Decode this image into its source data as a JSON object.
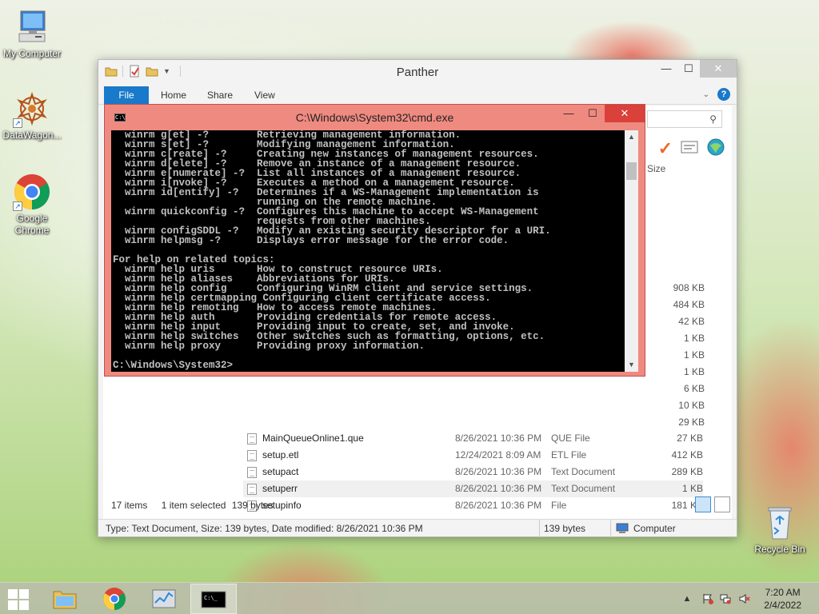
{
  "desktop": {
    "icons": [
      {
        "label": "My Computer",
        "icon": "computer-icon"
      },
      {
        "label": "DataWagon...",
        "icon": "datawagon-icon"
      },
      {
        "label": "Google Chrome",
        "icon": "chrome-icon"
      },
      {
        "label": "Recycle Bin",
        "icon": "recycle-bin-icon"
      }
    ]
  },
  "explorer": {
    "title": "Panther",
    "tabs": {
      "file": "File",
      "home": "Home",
      "share": "Share",
      "view": "View"
    },
    "column_size": "Size",
    "sizes_above": [
      "908 KB",
      "484 KB",
      "42 KB",
      "1 KB",
      "1 KB",
      "1 KB",
      "6 KB",
      "10 KB",
      "29 KB"
    ],
    "files": [
      {
        "name": "MainQueueOnline1.que",
        "date": "8/26/2021 10:36 PM",
        "type": "QUE File",
        "size": "27 KB"
      },
      {
        "name": "setup.etl",
        "date": "12/24/2021 8:09 AM",
        "type": "ETL File",
        "size": "412 KB"
      },
      {
        "name": "setupact",
        "date": "8/26/2021 10:36 PM",
        "type": "Text Document",
        "size": "289 KB"
      },
      {
        "name": "setuperr",
        "date": "8/26/2021 10:36 PM",
        "type": "Text Document",
        "size": "1 KB"
      },
      {
        "name": "setupinfo",
        "date": "8/26/2021 10:36 PM",
        "type": "File",
        "size": "181 KB"
      }
    ],
    "status": {
      "items": "17 items",
      "selected": "1 item selected",
      "selected_size": "139 bytes"
    },
    "statusbar": {
      "info": "Type: Text Document, Size: 139 bytes, Date modified: 8/26/2021 10:36 PM",
      "size": "139 bytes",
      "location": "Computer"
    }
  },
  "cmd": {
    "title": "C:\\Windows\\System32\\cmd.exe",
    "lines": [
      "  winrm g[et] -?        Retrieving management information.",
      "  winrm s[et] -?        Modifying management information.",
      "  winrm c[reate] -?     Creating new instances of management resources.",
      "  winrm d[elete] -?     Remove an instance of a management resource.",
      "  winrm e[numerate] -?  List all instances of a management resource.",
      "  winrm i[nvoke] -?     Executes a method on a management resource.",
      "  winrm id[entify] -?   Determines if a WS-Management implementation is",
      "                        running on the remote machine.",
      "  winrm quickconfig -?  Configures this machine to accept WS-Management",
      "                        requests from other machines.",
      "  winrm configSDDL -?   Modify an existing security descriptor for a URI.",
      "  winrm helpmsg -?      Displays error message for the error code.",
      "",
      "For help on related topics:",
      "  winrm help uris       How to construct resource URIs.",
      "  winrm help aliases    Abbreviations for URIs.",
      "  winrm help config     Configuring WinRM client and service settings.",
      "  winrm help certmapping Configuring client certificate access.",
      "  winrm help remoting   How to access remote machines.",
      "  winrm help auth       Providing credentials for remote access.",
      "  winrm help input      Providing input to create, set, and invoke.",
      "  winrm help switches   Other switches such as formatting, options, etc.",
      "  winrm help proxy      Providing proxy information.",
      "",
      "C:\\Windows\\System32>"
    ]
  },
  "taskbar": {
    "clock_time": "7:20 AM",
    "clock_date": "2/4/2022"
  },
  "colors": {
    "accent": "#1979ca",
    "cmd_frame": "#ef8a80",
    "cmd_close": "#d9413a"
  }
}
